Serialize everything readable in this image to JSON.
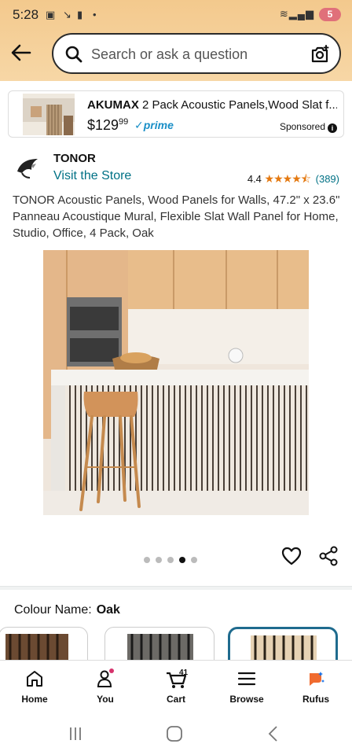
{
  "status_bar": {
    "time": "5:28",
    "battery": "5"
  },
  "search": {
    "placeholder": "Search or ask a question"
  },
  "sponsored_ad": {
    "brand": "AKUMAX",
    "title_rest": " 2 Pack Acoustic Panels,Wood Slat f...",
    "price_dollars": "$129",
    "price_cents": "99",
    "prime_label": "prime",
    "sponsored_label": "Sponsored"
  },
  "product": {
    "brand_name": "TONOR",
    "visit_store": "Visit the Store",
    "rating_value": "4.4",
    "rating_stars": 4.4,
    "rating_count": "(389)",
    "title": "TONOR Acoustic Panels, Wood Panels for Walls, 47.2\" x 23.6\" Panneau Acoustique Mural, Flexible Slat Wall Panel for Home, Studio, Office, 4 Pack, Oak",
    "image_count": 5,
    "active_image_index": 3
  },
  "colour": {
    "label": "Colour Name:",
    "value": "Oak"
  },
  "bottom_nav": {
    "items": [
      {
        "label": "Home",
        "icon": "home-icon"
      },
      {
        "label": "You",
        "icon": "person-icon"
      },
      {
        "label": "Cart",
        "icon": "cart-icon",
        "badge": "41"
      },
      {
        "label": "Browse",
        "icon": "menu-icon"
      },
      {
        "label": "Rufus",
        "icon": "rufus-icon"
      }
    ]
  },
  "colors": {
    "accent_teal": "#007185",
    "star_orange": "#e47911",
    "top_bar": "#f3c98d",
    "selected_border": "#1f6b8e"
  }
}
